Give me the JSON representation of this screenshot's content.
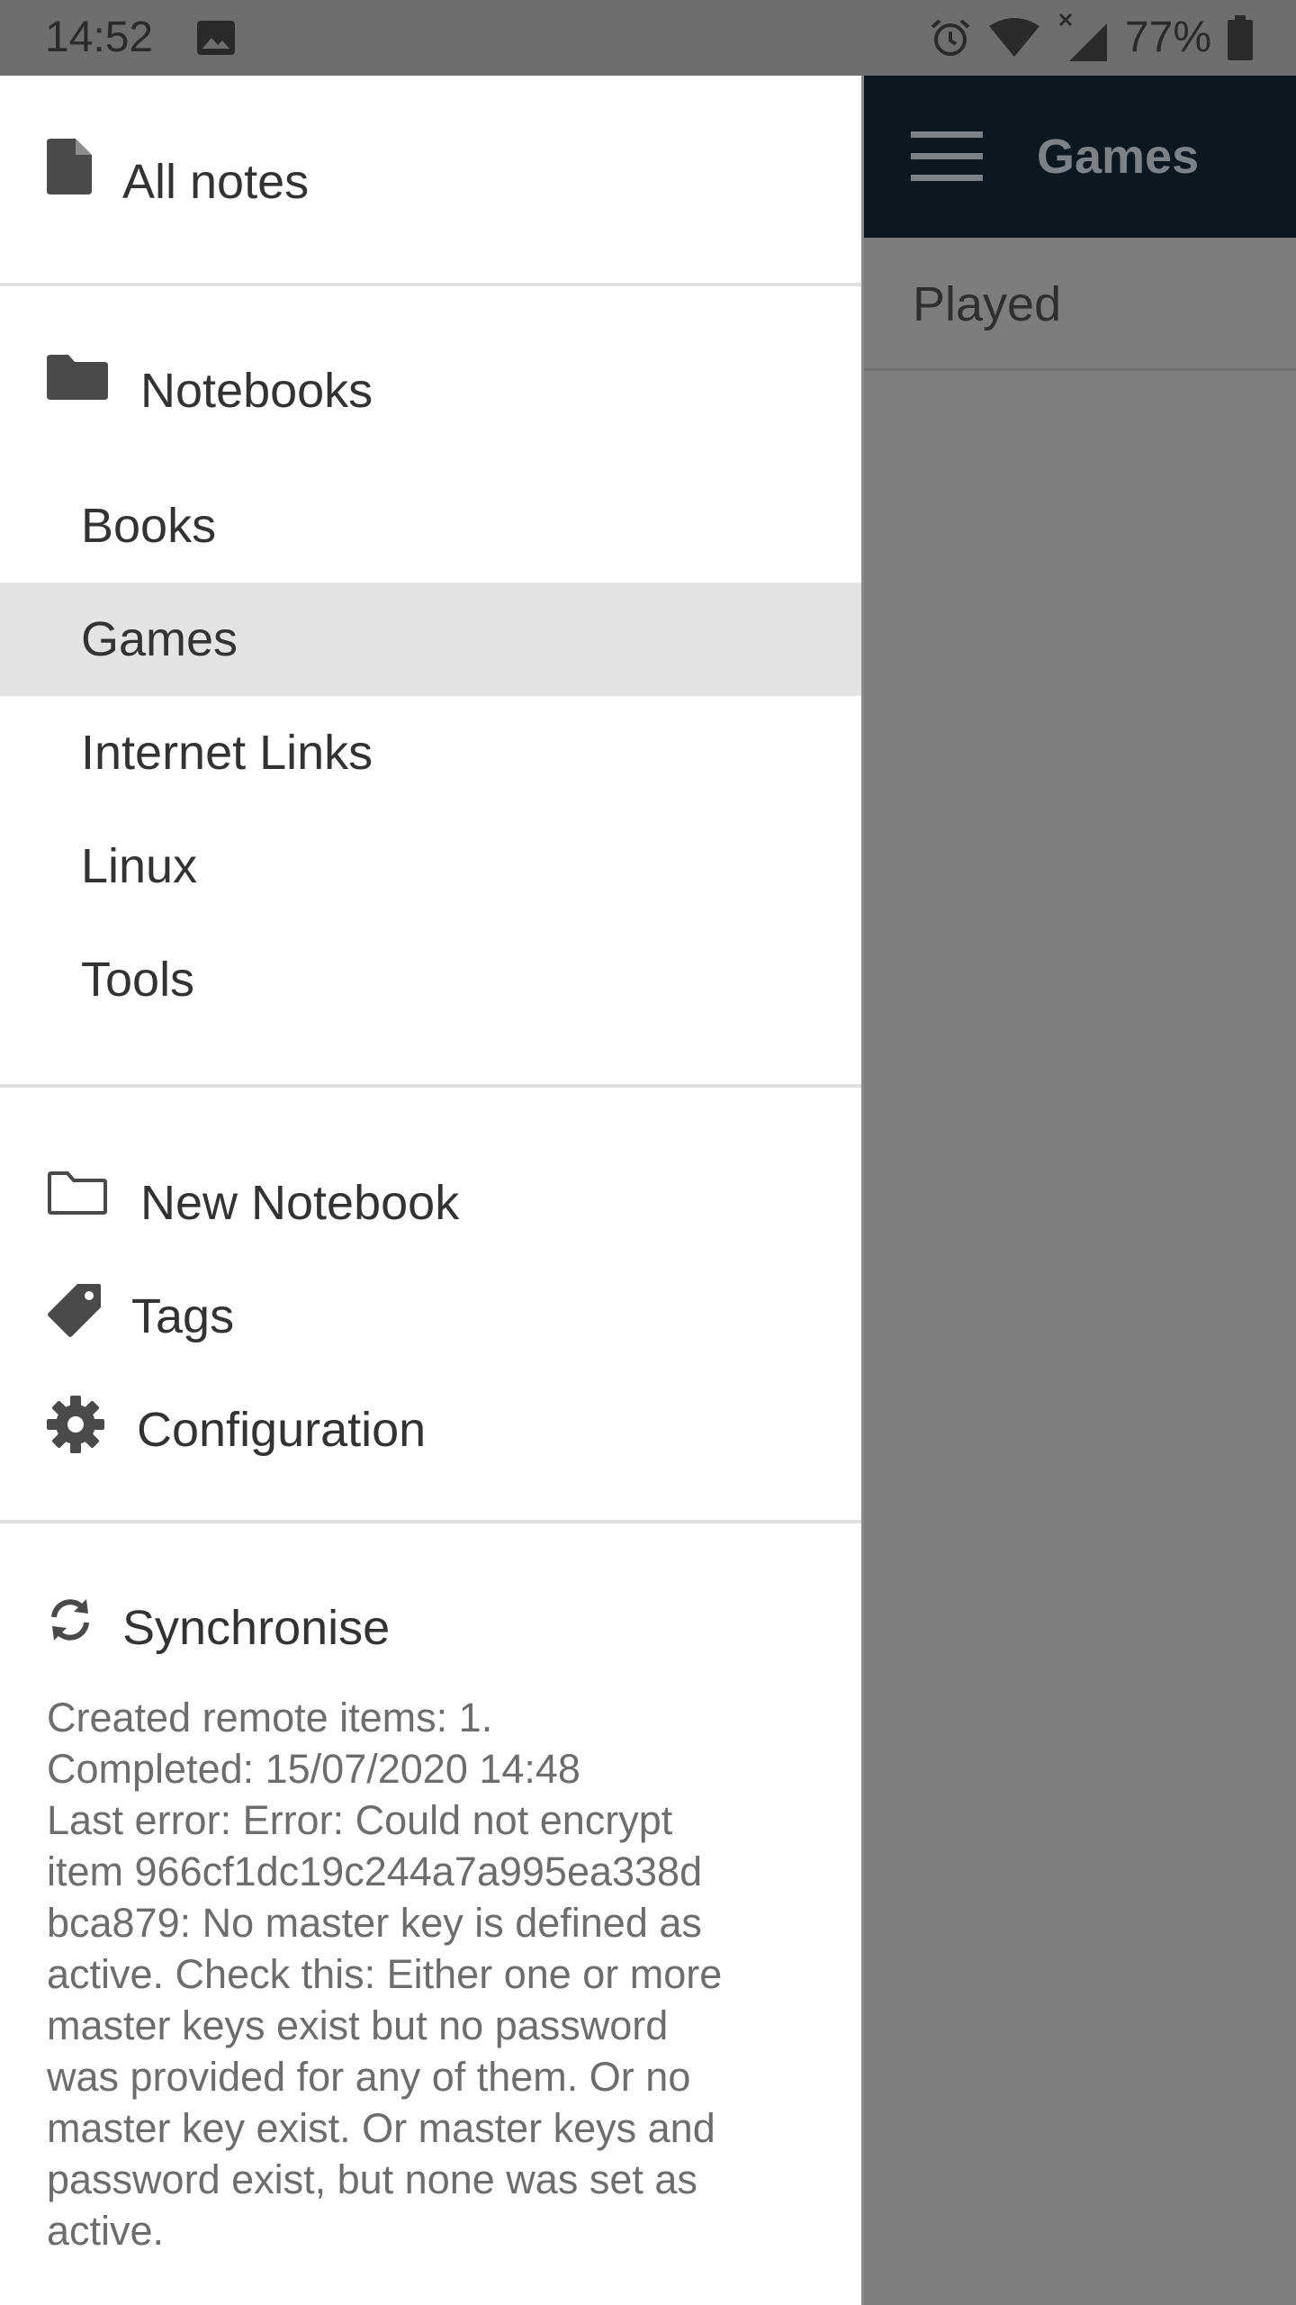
{
  "status_bar": {
    "time": "14:52",
    "battery_percent": "77%",
    "icons": [
      "image-icon",
      "alarm-icon",
      "wifi-icon",
      "signal-icon",
      "battery-icon"
    ]
  },
  "app_bar": {
    "title": "Games",
    "menu_icon": "hamburger-icon",
    "background_color": "#0d1720"
  },
  "note_list": {
    "items": [
      {
        "title": "Played"
      }
    ]
  },
  "drawer": {
    "all_notes": {
      "label": "All notes",
      "icon": "file-icon"
    },
    "notebooks": {
      "label": "Notebooks",
      "icon": "folder-icon",
      "items": [
        {
          "label": "Books",
          "selected": false
        },
        {
          "label": "Games",
          "selected": true
        },
        {
          "label": "Internet Links",
          "selected": false
        },
        {
          "label": "Linux",
          "selected": false
        },
        {
          "label": "Tools",
          "selected": false
        }
      ]
    },
    "actions": [
      {
        "label": "New Notebook",
        "icon": "folder-outline-icon"
      },
      {
        "label": "Tags",
        "icon": "tag-icon"
      },
      {
        "label": "Configuration",
        "icon": "gear-icon"
      }
    ],
    "sync": {
      "label": "Synchronise",
      "icon": "sync-icon",
      "log": "Created remote items: 1.\nCompleted: 15/07/2020 14:48\nLast error: Error: Could not encrypt\nitem 966cf1dc19c244a7a995ea338d\nbca879: No master key is defined as\nactive. Check this: Either one or more\nmaster keys exist but no password\nwas provided for any of them. Or no\nmaster key exist. Or master keys and\npassword exist, but none was set as\nactive."
    }
  }
}
